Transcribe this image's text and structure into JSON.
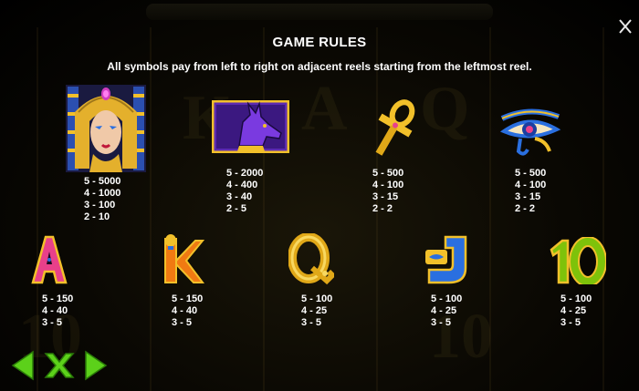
{
  "rules": {
    "title": "GAME RULES",
    "subtitle": "All symbols pay from left to right on adjacent reels starting from the leftmost reel."
  },
  "symbols_row1": [
    {
      "name": "Cleopatra",
      "icon": "cleopatra-icon",
      "pays": [
        "5 - 5000",
        "4 - 1000",
        "3 - 100",
        "2 - 10"
      ]
    },
    {
      "name": "Anubis",
      "icon": "anubis-icon",
      "pays": [
        "5 - 2000",
        "4 - 400",
        "3 - 40",
        "2 - 5"
      ]
    },
    {
      "name": "Ankh",
      "icon": "ankh-icon",
      "pays": [
        "5 - 500",
        "4 - 100",
        "3 - 15",
        "2 - 2"
      ]
    },
    {
      "name": "Eye of Horus",
      "icon": "eye-of-horus-icon",
      "pays": [
        "5 - 500",
        "4 - 100",
        "3 - 15",
        "2 - 2"
      ]
    }
  ],
  "symbols_row2": [
    {
      "label": "A",
      "icon": "a-card-icon",
      "pays": [
        "5 - 150",
        "4 - 40",
        "3 - 5"
      ]
    },
    {
      "label": "K",
      "icon": "k-card-icon",
      "pays": [
        "5 - 150",
        "4 - 40",
        "3 - 5"
      ]
    },
    {
      "label": "Q",
      "icon": "q-card-icon",
      "pays": [
        "5 - 100",
        "4 - 25",
        "3 - 5"
      ]
    },
    {
      "label": "J",
      "icon": "j-card-icon",
      "pays": [
        "5 - 100",
        "4 - 25",
        "3 - 5"
      ]
    },
    {
      "label": "10",
      "icon": "ten-card-icon",
      "pays": [
        "5 - 100",
        "4 - 25",
        "3 - 5"
      ]
    }
  ],
  "nav": {
    "prev_icon": "arrow-left-icon",
    "close_icon": "x-icon",
    "next_icon": "arrow-right-icon"
  },
  "colors": {
    "nav_green": "#5cd11a",
    "gold": "#f2c02a",
    "pink": "#e8408a",
    "orange": "#f07a12",
    "blue": "#2a6fe0",
    "green_card": "#7ec20a"
  }
}
